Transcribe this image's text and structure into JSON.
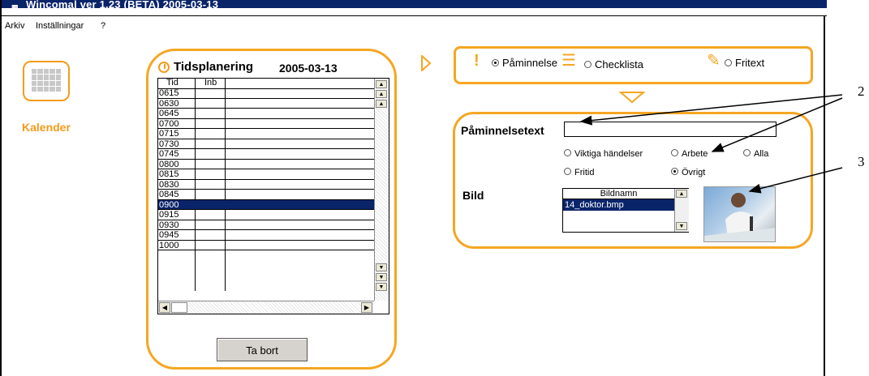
{
  "window": {
    "title": "Wincomal ver 1.23 (BETA) 2005-03-13"
  },
  "menu": [
    "Arkiv",
    "Inställningar",
    "?"
  ],
  "sidebar": {
    "calendar_label": "Kalender"
  },
  "schedule": {
    "title": "Tidsplanering",
    "date": "2005-03-13",
    "columns": [
      "Tid",
      "Inb"
    ],
    "times": [
      "0615",
      "0630",
      "0645",
      "0700",
      "0715",
      "0730",
      "0745",
      "0800",
      "0815",
      "0830",
      "0845",
      "0900",
      "0915",
      "0930",
      "0945",
      "1000"
    ],
    "selected_time": "0900",
    "delete_button": "Ta bort"
  },
  "type_options": [
    {
      "label": "Påminnelse",
      "selected": true,
      "icon": "exclamation-icon"
    },
    {
      "label": "Checklista",
      "selected": false,
      "icon": "checklist-icon"
    },
    {
      "label": "Fritext",
      "selected": false,
      "icon": "pencil-icon"
    }
  ],
  "reminder": {
    "text_label": "Påminnelsetext",
    "text_value": "",
    "categories": [
      {
        "label": "Viktiga händelser",
        "selected": false
      },
      {
        "label": "Arbete",
        "selected": false
      },
      {
        "label": "Alla",
        "selected": false
      },
      {
        "label": "Fritid",
        "selected": false
      },
      {
        "label": "Övrigt",
        "selected": true
      }
    ],
    "image_label": "Bild",
    "image_list_header": "Bildnamn",
    "image_selected": "14_doktor.bmp"
  },
  "callouts": [
    "2",
    "3"
  ],
  "colors": {
    "accent": "#f5a623",
    "selection": "#0a246a",
    "titlebar": "#0a246a"
  }
}
